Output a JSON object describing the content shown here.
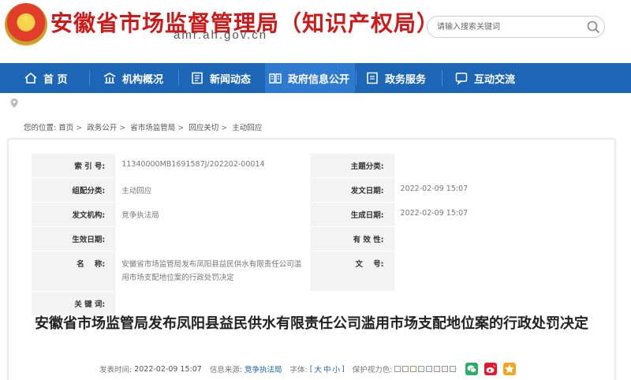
{
  "header": {
    "site_title": "安徽省市场监督管理局（知识产权局）",
    "site_domain": "amr.ah.gov.cn",
    "search_placeholder": "请输入搜索关键词"
  },
  "nav": [
    {
      "label": "首 页",
      "icon": "home-icon"
    },
    {
      "label": "机构概况",
      "icon": "building-icon"
    },
    {
      "label": "新闻动态",
      "icon": "news-icon"
    },
    {
      "label": "政府信息公开",
      "icon": "book-icon"
    },
    {
      "label": "政务服务",
      "icon": "service-icon"
    },
    {
      "label": "互动交流",
      "icon": "chat-icon"
    }
  ],
  "breadcrumb": [
    "您的位置:",
    "首页",
    "政务公开",
    "省市场监管局",
    "回应关切",
    "主动回应"
  ],
  "meta": {
    "index_label": "索 引 号:",
    "index_value": "11340000MB1691587J/202202-00014",
    "topic_label": "主题分类:",
    "topic_value": "",
    "category_label": "组配分类:",
    "category_value": "主动回应",
    "pubdate_label": "发文日期:",
    "pubdate_value": "2022-02-09 15:07",
    "org_label": "发文机构:",
    "org_value": "竞争执法局",
    "created_label": "生成日期:",
    "created_value": "2022-02-09 15:07",
    "effective_label": "生效日期:",
    "effective_value": "",
    "validity_label": "有 效 性:",
    "validity_value": "",
    "name_label": "名    称:",
    "name_value": "安徽省市场监管局发布凤阳县益民供水有限责任公司滥用市场支配地位案的行政处罚决定",
    "docno_label": "文    号:",
    "docno_value": "",
    "keywords_label": "关 键 词:",
    "keywords_value": ""
  },
  "article": {
    "title": "安徽省市场监管局发布凤阳县益民供水有限责任公司滥用市场支配地位案的行政处罚决定",
    "time_label": "发表时间:",
    "time_value": "2022-02-09 15:07",
    "source_label": "信息来源:",
    "source_value": "竞争执法局",
    "font_label": "字体:",
    "font_open": "[",
    "font_large": "大",
    "font_medium": "中",
    "font_small": "小",
    "font_close": "]",
    "eye_label": "保护视力色:",
    "eye_swatches": [
      "#ffffff",
      "#faf8eb",
      "#fdfde3",
      "#f0f5ea",
      "#eaf2fa",
      "#f5efef",
      "#efefef",
      "#f2f2f2"
    ]
  },
  "colors": {
    "brand_red": "#d01818",
    "nav_blue": "#1d65b5",
    "wechat_green": "#2aae67",
    "weibo_red": "#e6162d",
    "qzone_orange": "#f7a21b"
  }
}
